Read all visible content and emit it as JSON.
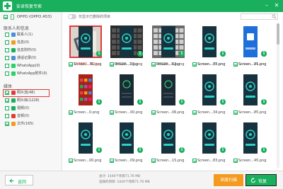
{
  "app": {
    "title": "安卓恢复专家",
    "brand_color": "#1aaf5d",
    "controls": [
      "minimize-icon",
      "close-icon"
    ]
  },
  "sidebar": {
    "device": "OPPO (OPPO A53)",
    "sections": [
      {
        "heading": "联系人和信息",
        "items": [
          {
            "label": "联系人(1)",
            "checked": false,
            "icon": "contacts-icon",
            "color": "#4a90d9"
          },
          {
            "label": "信息(0)",
            "checked": false,
            "icon": "messages-icon",
            "color": "#f39a1f"
          },
          {
            "label": "信息附件(0)",
            "checked": false,
            "icon": "attachment-icon",
            "color": "#1aaf5d"
          },
          {
            "label": "通话记录(0)",
            "checked": false,
            "icon": "call-log-icon",
            "color": "#4a90d9"
          },
          {
            "label": "WhatsApp(0)",
            "checked": false,
            "icon": "whatsapp-icon",
            "color": "#25d366"
          },
          {
            "label": "WhatsApp附件(0)",
            "checked": false,
            "icon": "whatsapp-attachment-icon",
            "color": "#25d366"
          }
        ]
      },
      {
        "heading": "媒体",
        "items": [
          {
            "label": "照片流(48)",
            "checked": true,
            "icon": "photo-stream-icon",
            "color": "#e23b3b"
          },
          {
            "label": "照片库(1228)",
            "checked": true,
            "icon": "photo-library-icon",
            "color": "#1aaf5d"
          },
          {
            "label": "视频(0)",
            "checked": false,
            "icon": "video-icon",
            "color": "#1aaf5d"
          },
          {
            "label": "音频(0)",
            "checked": false,
            "icon": "audio-icon",
            "color": "#e23b3b"
          },
          {
            "label": "文件(165)",
            "checked": true,
            "icon": "file-icon",
            "color": "#f39a1f"
          }
        ]
      }
    ]
  },
  "filter": {
    "toggle_label": "仅显示已删除的项目",
    "search_placeholder": ""
  },
  "grid": {
    "items": [
      {
        "filename": "157883...62.jpg",
        "checked": true,
        "selected": true,
        "thumb": "phone-photo"
      },
      {
        "filename": "IMG20...1.jpg",
        "checked": true,
        "selected": false,
        "thumb": "keyboard-dark"
      },
      {
        "filename": "IMG20...3.jpg",
        "checked": true,
        "selected": false,
        "thumb": "keyboard-light"
      },
      {
        "filename": "Screen...37.png",
        "checked": true,
        "selected": false,
        "thumb": "screen-list"
      },
      {
        "filename": "Screen...21.png",
        "checked": true,
        "selected": false,
        "thumb": "screen-list"
      },
      {
        "filename": "Screen...0.png",
        "checked": true,
        "selected": false,
        "thumb": "screen-colorful"
      },
      {
        "filename": "Screen...00.png",
        "checked": true,
        "selected": false,
        "thumb": "screen-dark"
      },
      {
        "filename": "Screen...06.png",
        "checked": true,
        "selected": false,
        "thumb": "screen-dark"
      },
      {
        "filename": "Screen...34.png",
        "checked": true,
        "selected": false,
        "thumb": "screen-gauge"
      },
      {
        "filename": "Screen...85.png",
        "checked": true,
        "selected": false,
        "thumb": "screen-gauge"
      },
      {
        "filename": "Screen...00.png",
        "checked": true,
        "selected": false,
        "thumb": "screen-gauge"
      },
      {
        "filename": "Screen...09.png",
        "checked": true,
        "selected": false,
        "thumb": "screen-gauge"
      },
      {
        "filename": "Screen...15.png",
        "checked": true,
        "selected": false,
        "thumb": "screen-gauge"
      },
      {
        "filename": "Screen...83.png",
        "checked": true,
        "selected": false,
        "thumb": "screen-gauge"
      },
      {
        "filename": "Screen...45.png",
        "checked": true,
        "selected": false,
        "thumb": "screen-gauge"
      },
      {
        "filename": "Screen...36.png",
        "checked": true,
        "selected": false,
        "thumb": "screen-gauge"
      },
      {
        "filename": "Screen...30.png",
        "checked": true,
        "selected": false,
        "thumb": "screen-gauge"
      },
      {
        "filename": "Screen...42.png",
        "checked": true,
        "selected": false,
        "thumb": "screen-gauge"
      },
      {
        "filename": "Screen...85.png",
        "checked": true,
        "selected": false,
        "thumb": "screen-gauge"
      },
      {
        "filename": "Screen...85.png",
        "checked": true,
        "selected": false,
        "thumb": "screen-blue"
      }
    ]
  },
  "bottom": {
    "back_label": "返回",
    "total_line": "总计: 1440个项目71.76 MB",
    "selected_line": "选择的项目: 1440个项目71.76 MB",
    "deep_scan_label": "深度扫描",
    "restore_label": "恢复"
  }
}
